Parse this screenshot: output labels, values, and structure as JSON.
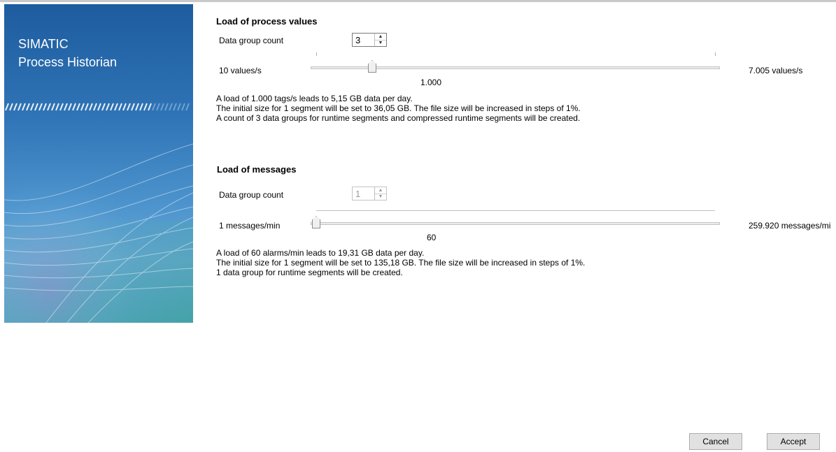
{
  "banner": {
    "title_line1": "SIMATIC",
    "title_line2": "Process Historian"
  },
  "process_values": {
    "title": "Load of process values",
    "data_group_label": "Data group count",
    "data_group_value": "3",
    "slider_min_label": "10 values/s",
    "slider_max_label": "7.005 values/s",
    "slider_value_label": "1.000",
    "slider_value": 1000,
    "slider_min": 10,
    "slider_max": 7005,
    "desc_line1": "A load of 1.000 tags/s leads to 5,15 GB data per day.",
    "desc_line2": "The initial size for 1 segment will be set to 36,05 GB. The file size will be increased in steps of 1%.",
    "desc_line3": "A count of 3 data groups for runtime segments and compressed runtime segments will be created."
  },
  "messages": {
    "title": "Load of messages",
    "data_group_label": "Data group count",
    "data_group_value": "1",
    "slider_min_label": "1 messages/min",
    "slider_max_label": "259.920 messages/mi",
    "slider_value_label": "60",
    "slider_value": 60,
    "slider_min": 1,
    "slider_max": 259920,
    "desc_line1": "A load of 60 alarms/min leads to 19,31 GB data per day.",
    "desc_line2": "The initial size for 1 segment will be set to 135,18 GB. The file size will be increased in steps of 1%.",
    "desc_line3": "1 data group for runtime segments will be created."
  },
  "buttons": {
    "cancel": "Cancel",
    "accept": "Accept"
  },
  "colors": {
    "banner_top": "#1d5c9f",
    "banner_bottom": "#5a9fc4"
  }
}
